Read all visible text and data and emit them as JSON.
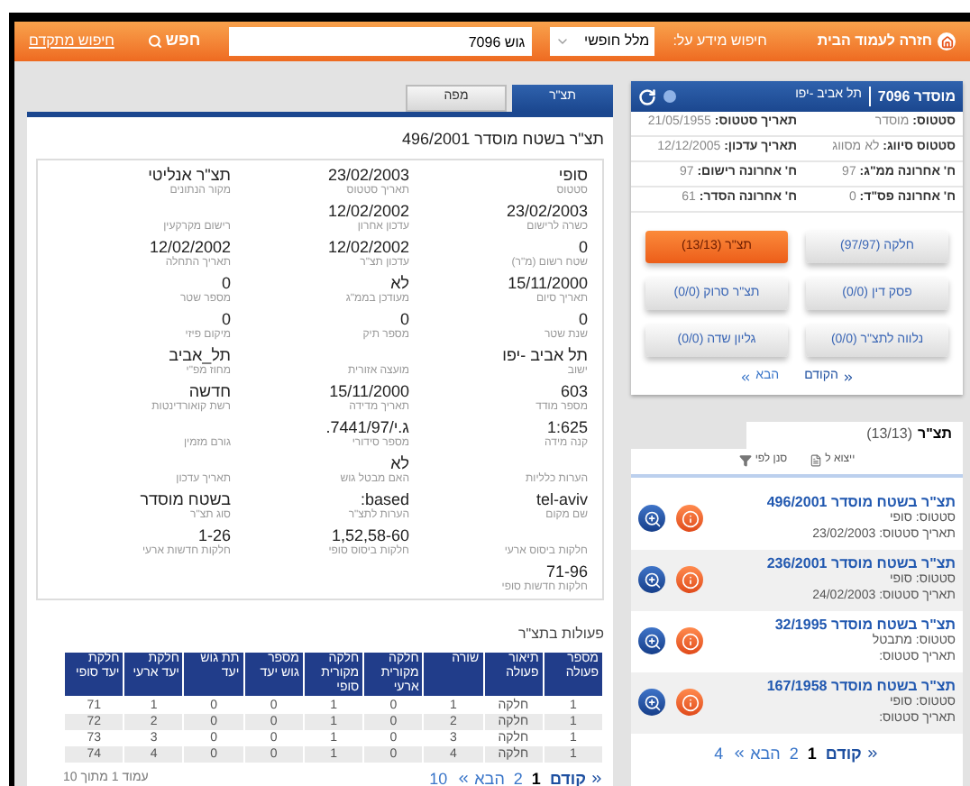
{
  "top_bar": {
    "home_link": "חזרה לעמוד הבית",
    "search_label": "חיפוש מידע על:",
    "search_type": "מלל חופשי",
    "search_value": "גוש 7096",
    "search_button": "חפש",
    "advanced_link": "חיפוש מתקדם"
  },
  "parcel_panel": {
    "title": "מוסדר 7096",
    "subtitle": "תל אביב -יפו",
    "info": [
      {
        "label": "סטטוס:",
        "value": "מוסדר"
      },
      {
        "label": "תאריך סטטוס:",
        "value": "21/05/1955"
      },
      {
        "label": "סטטוס סיווג:",
        "value": "לא מסווג"
      },
      {
        "label": "תאריך עדכון:",
        "value": "12/12/2005"
      },
      {
        "label": "ח' אחרונה ממ\"ג:",
        "value": "97"
      },
      {
        "label": "ח' אחרונה רישום:",
        "value": "97"
      },
      {
        "label": "ח' אחרונה פס\"ד:",
        "value": "0"
      },
      {
        "label": "ח' אחרונה הסדר:",
        "value": "61"
      }
    ],
    "buttons": [
      {
        "label": "חלקה (97/97)",
        "selected": false
      },
      {
        "label": "תצ\"ר (13/13)",
        "selected": true
      },
      {
        "label": "פסק דין (0/0)",
        "selected": false
      },
      {
        "label": "תצ\"ר סרוק (0/0)",
        "selected": false
      },
      {
        "label": "נלווה לתצ\"ר (0/0)",
        "selected": false
      },
      {
        "label": "גליון שדה (0/0)",
        "selected": false
      }
    ],
    "pager": {
      "prev": "הקודם",
      "next": "הבא"
    }
  },
  "plans_panel": {
    "tab": "תצ\"ר",
    "count": "(13/13)",
    "export": "ייצוא ל",
    "filter": "סנן לפי",
    "items": [
      {
        "title": "תצ\"ר בשטח מוסדר 496/2001",
        "status": "סטטוס: סופי",
        "date": "תאריך סטטוס: 23/02/2003"
      },
      {
        "title": "תצ\"ר בשטח מוסדר 236/2001",
        "status": "סטטוס: סופי",
        "date": "תאריך סטטוס: 24/02/2003"
      },
      {
        "title": "תצ\"ר בשטח מוסדר 32/1995",
        "status": "סטטוס: מתבטל",
        "date": "תאריך סטטוס:"
      },
      {
        "title": "תצ\"ר בשטח מוסדר 167/1958",
        "status": "סטטוס: סופי",
        "date": "תאריך סטטוס:"
      }
    ],
    "pager": {
      "prev": "קודם",
      "pages": [
        {
          "label": "1",
          "selected": true
        },
        {
          "label": "2",
          "selected": false
        }
      ],
      "next": "הבא",
      "last": "4"
    }
  },
  "tabs": [
    {
      "label": "תצ\"ר",
      "selected": true
    },
    {
      "label": "מפה",
      "selected": false
    }
  ],
  "plan": {
    "title": "תצ\"ר בשטח מוסדר 496/2001",
    "fields": [
      {
        "value": "סופי",
        "label": "סטטוס"
      },
      {
        "value": "23/02/2003",
        "label": "תאריך סטטוס"
      },
      {
        "value": "תצ\"ר אנליטי",
        "label": "מקור הנתונים"
      },
      {
        "value": "23/02/2003",
        "label": "כשרה לרישום"
      },
      {
        "value": "12/02/2002",
        "label": "עדכון אחרון"
      },
      {
        "label": "רישום מקרקעין"
      },
      {
        "value": "0",
        "label": "שטח רשום (מ\"ר)"
      },
      {
        "value": "12/02/2002",
        "label": "עדכון תצ\"ר"
      },
      {
        "value": "12/02/2002",
        "label": "תאריך התחלה"
      },
      {
        "value": "15/11/2000",
        "label": "תאריך סיום"
      },
      {
        "value": "לא",
        "label": "מעודכן בממ\"ג"
      },
      {
        "value": "0",
        "label": "מספר שטר"
      },
      {
        "value": "0",
        "label": "שנת שטר"
      },
      {
        "value": "0",
        "label": "מספר תיק"
      },
      {
        "value": "0",
        "label": "מיקום פיזי"
      },
      {
        "value": "תל אביב -יפו",
        "label": "ישוב"
      },
      {
        "label": "מועצה אזורית"
      },
      {
        "value": "תל_אביב",
        "label": "מחוז מפ\"י"
      },
      {
        "value": "603",
        "label": "מספר מודד"
      },
      {
        "value": "15/11/2000",
        "label": "תאריך מדידה"
      },
      {
        "value": "חדשה",
        "label": "רשת קואורדינטות"
      },
      {
        "value": "1:625",
        "label": "קנה מידה"
      },
      {
        "value": "ג.י/7441/97.",
        "label": "מספר סידורי"
      },
      {
        "label": "גורם מזמין"
      },
      {
        "label": "הערות כלליות"
      },
      {
        "value": "לא",
        "label": "האם מבטל גוש"
      },
      {
        "label": "תאריך עדכון"
      },
      {
        "value": "tel-aviv",
        "label": "שם מקום"
      },
      {
        "value": "based:",
        "label": "הערות לתצ\"ר"
      },
      {
        "value": "בשטח מוסדר",
        "label": "סוג תצ\"ר"
      },
      {
        "label": "חלקות ביסוס ארעי"
      },
      {
        "value": "1,52,58-60",
        "label": "חלקות ביסוס סופי"
      },
      {
        "value": "1-26",
        "label": "חלקות חדשות ארעי"
      },
      {
        "value": "71-96",
        "label": "חלקות חדשות סופי"
      }
    ]
  },
  "actions": {
    "title": "פעולות בתצ\"ר",
    "columns": [
      "מספר פעולה",
      "תיאור פעולה",
      "שורה",
      "חלקה מקורית ארעי",
      "חלקה מקורית סופי",
      "מספר גוש יעד",
      "תת גוש יעד",
      "חלקת יעד ארעי",
      "חלקת יעד סופי"
    ],
    "rows": [
      [
        "1",
        "חלקה",
        "1",
        "0",
        "1",
        "0",
        "0",
        "1",
        "71"
      ],
      [
        "1",
        "חלקה",
        "2",
        "0",
        "1",
        "0",
        "0",
        "2",
        "72"
      ],
      [
        "1",
        "חלקה",
        "3",
        "0",
        "1",
        "0",
        "0",
        "3",
        "73"
      ],
      [
        "1",
        "חלקה",
        "4",
        "0",
        "1",
        "0",
        "0",
        "4",
        "74"
      ]
    ],
    "pager": {
      "prev": "קודם",
      "pages": [
        {
          "label": "1",
          "selected": true
        },
        {
          "label": "2",
          "selected": false
        }
      ],
      "next": "הבא",
      "last": "10"
    },
    "page_info": "עמוד 1 מתוך 10"
  }
}
